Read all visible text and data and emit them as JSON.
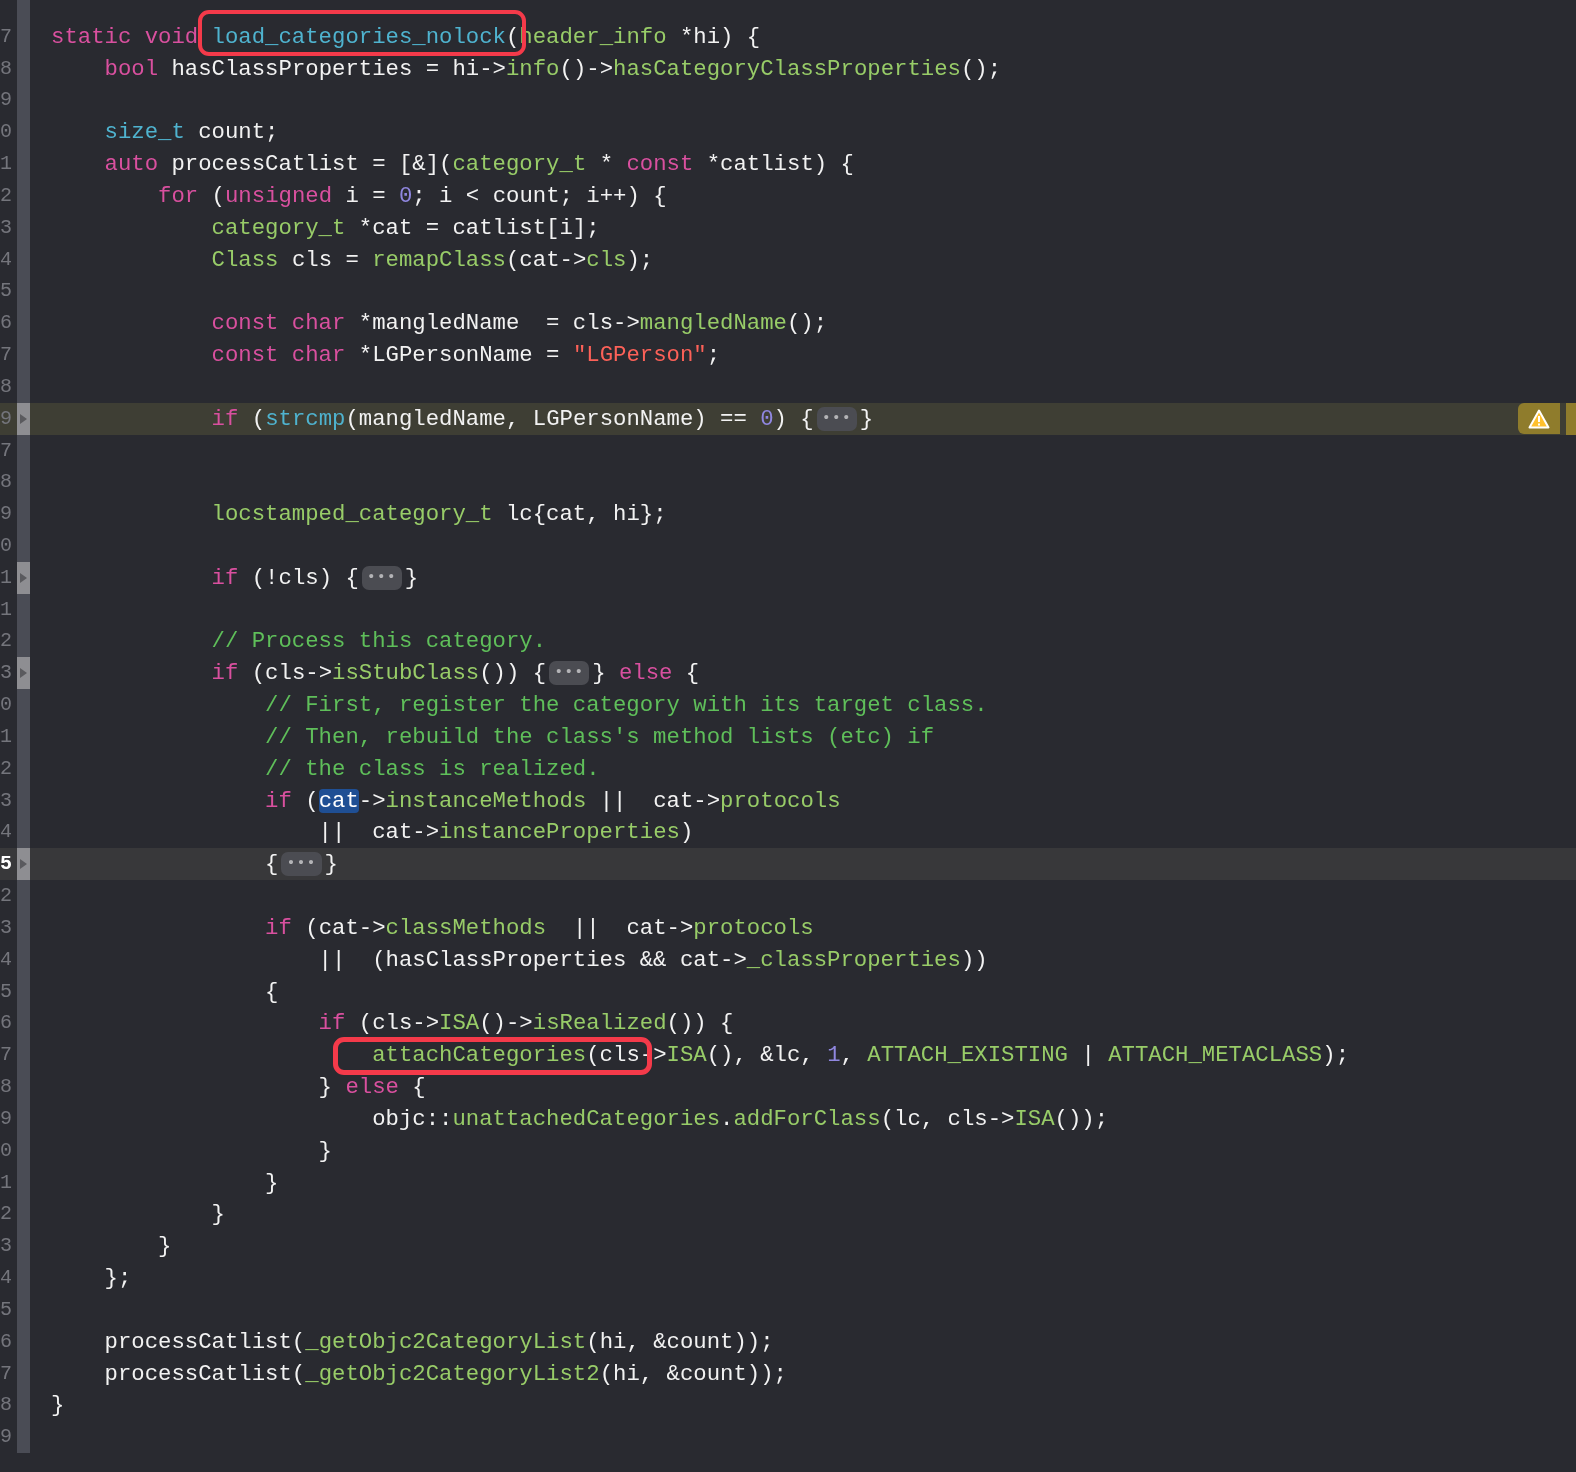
{
  "lines": [
    {
      "folded": false,
      "current": false,
      "warning": false
    },
    {
      "number": "7",
      "folded": false,
      "current": false,
      "warning": false,
      "tokens": [
        {
          "text": "static void",
          "kind": "keyword"
        },
        {
          "text": " load_categories_nolock",
          "kind": "declaration"
        },
        {
          "text": "(",
          "kind": "plain"
        },
        {
          "text": "header_info",
          "kind": "project"
        },
        {
          "text": " *hi) {",
          "kind": "plain"
        }
      ]
    },
    {
      "number": "8",
      "folded": false,
      "current": false,
      "warning": false,
      "tokens": [
        {
          "text": "    bool",
          "kind": "keyword"
        },
        {
          "text": " hasClassProperties = hi->",
          "kind": "plain"
        },
        {
          "text": "info",
          "kind": "project"
        },
        {
          "text": "()->",
          "kind": "plain"
        },
        {
          "text": "hasCategoryClassProperties",
          "kind": "project"
        },
        {
          "text": "();",
          "kind": "plain"
        }
      ]
    },
    {
      "number": "9",
      "folded": false,
      "current": false,
      "warning": false
    },
    {
      "number": "0",
      "folded": false,
      "current": false,
      "warning": false,
      "tokens": [
        {
          "text": "    size_t",
          "kind": "declaration"
        },
        {
          "text": " count;",
          "kind": "plain"
        }
      ]
    },
    {
      "number": "1",
      "folded": false,
      "current": false,
      "warning": false,
      "tokens": [
        {
          "text": "    auto",
          "kind": "keyword"
        },
        {
          "text": " processCatlist = [&](",
          "kind": "plain"
        },
        {
          "text": "category_t",
          "kind": "project"
        },
        {
          "text": " * ",
          "kind": "plain"
        },
        {
          "text": "const",
          "kind": "keyword"
        },
        {
          "text": " *catlist) {",
          "kind": "plain"
        }
      ]
    },
    {
      "number": "2",
      "folded": false,
      "current": false,
      "warning": false,
      "tokens": [
        {
          "text": "        for",
          "kind": "keyword"
        },
        {
          "text": " (",
          "kind": "plain"
        },
        {
          "text": "unsigned",
          "kind": "keyword"
        },
        {
          "text": " i = ",
          "kind": "plain"
        },
        {
          "text": "0",
          "kind": "number"
        },
        {
          "text": "; i < count; i++) {",
          "kind": "plain"
        }
      ]
    },
    {
      "number": "3",
      "folded": false,
      "current": false,
      "warning": false,
      "tokens": [
        {
          "text": "            category_t",
          "kind": "project"
        },
        {
          "text": " *cat = catlist[i];",
          "kind": "plain"
        }
      ]
    },
    {
      "number": "4",
      "folded": false,
      "current": false,
      "warning": false,
      "tokens": [
        {
          "text": "            Class",
          "kind": "project"
        },
        {
          "text": " cls = ",
          "kind": "plain"
        },
        {
          "text": "remapClass",
          "kind": "project"
        },
        {
          "text": "(cat->",
          "kind": "plain"
        },
        {
          "text": "cls",
          "kind": "project"
        },
        {
          "text": ");",
          "kind": "plain"
        }
      ]
    },
    {
      "number": "5",
      "folded": false,
      "current": false,
      "warning": false
    },
    {
      "number": "6",
      "folded": false,
      "current": false,
      "warning": false,
      "tokens": [
        {
          "text": "            const char",
          "kind": "keyword"
        },
        {
          "text": " *mangledName  = cls->",
          "kind": "plain"
        },
        {
          "text": "mangledName",
          "kind": "project"
        },
        {
          "text": "();",
          "kind": "plain"
        }
      ]
    },
    {
      "number": "7",
      "folded": false,
      "current": false,
      "warning": false,
      "tokens": [
        {
          "text": "            const char",
          "kind": "keyword"
        },
        {
          "text": " *LGPersonName = ",
          "kind": "plain"
        },
        {
          "text": "\"LGPerson\"",
          "kind": "string"
        },
        {
          "text": ";",
          "kind": "plain"
        }
      ]
    },
    {
      "number": "8",
      "folded": false,
      "current": false,
      "warning": false
    },
    {
      "number": "9",
      "folded": true,
      "current": false,
      "warning": true,
      "tokens": [
        {
          "text": "            if",
          "kind": "keyword"
        },
        {
          "text": " (",
          "kind": "plain"
        },
        {
          "text": "strcmp",
          "kind": "declaration"
        },
        {
          "text": "(mangledName, LGPersonName) == ",
          "kind": "plain"
        },
        {
          "text": "0",
          "kind": "number"
        },
        {
          "text": ") {",
          "kind": "plain"
        },
        {
          "text": "•••",
          "kind": "fold"
        },
        {
          "text": "}",
          "kind": "plain"
        }
      ]
    },
    {
      "number": "7",
      "folded": false,
      "current": false,
      "warning": false
    },
    {
      "number": "8",
      "folded": false,
      "current": false,
      "warning": false
    },
    {
      "number": "9",
      "folded": false,
      "current": false,
      "warning": false,
      "tokens": [
        {
          "text": "            locstamped_category_t",
          "kind": "project"
        },
        {
          "text": " lc{cat, hi};",
          "kind": "plain"
        }
      ]
    },
    {
      "number": "0",
      "folded": false,
      "current": false,
      "warning": false
    },
    {
      "number": "1",
      "folded": true,
      "current": false,
      "warning": false,
      "tokens": [
        {
          "text": "            if",
          "kind": "keyword"
        },
        {
          "text": " (!cls) {",
          "kind": "plain"
        },
        {
          "text": "•••",
          "kind": "fold"
        },
        {
          "text": "}",
          "kind": "plain"
        }
      ]
    },
    {
      "number": "1",
      "folded": false,
      "current": false,
      "warning": false
    },
    {
      "number": "2",
      "folded": false,
      "current": false,
      "warning": false,
      "tokens": [
        {
          "text": "            // Process this category.",
          "kind": "comment"
        }
      ]
    },
    {
      "number": "3",
      "folded": true,
      "current": false,
      "warning": false,
      "tokens": [
        {
          "text": "            if",
          "kind": "keyword"
        },
        {
          "text": " (cls->",
          "kind": "plain"
        },
        {
          "text": "isStubClass",
          "kind": "project"
        },
        {
          "text": "()) {",
          "kind": "plain"
        },
        {
          "text": "•••",
          "kind": "fold"
        },
        {
          "text": "} ",
          "kind": "plain"
        },
        {
          "text": "else",
          "kind": "keyword"
        },
        {
          "text": " {",
          "kind": "plain"
        }
      ]
    },
    {
      "number": "0",
      "folded": false,
      "current": false,
      "warning": false,
      "tokens": [
        {
          "text": "                // First, register the category with its target class.",
          "kind": "comment"
        }
      ]
    },
    {
      "number": "1",
      "folded": false,
      "current": false,
      "warning": false,
      "tokens": [
        {
          "text": "                // Then, rebuild the class's method lists (etc) if",
          "kind": "comment"
        }
      ]
    },
    {
      "number": "2",
      "folded": false,
      "current": false,
      "warning": false,
      "tokens": [
        {
          "text": "                // the class is realized.",
          "kind": "comment"
        }
      ]
    },
    {
      "number": "3",
      "folded": false,
      "current": false,
      "warning": false,
      "tokens": [
        {
          "text": "                if",
          "kind": "keyword"
        },
        {
          "text": " (",
          "kind": "plain"
        },
        {
          "text": "cat",
          "kind": "selection"
        },
        {
          "text": "->",
          "kind": "plain"
        },
        {
          "text": "instanceMethods",
          "kind": "project"
        },
        {
          "text": " ||  cat->",
          "kind": "plain"
        },
        {
          "text": "protocols",
          "kind": "project"
        }
      ]
    },
    {
      "number": "4",
      "folded": false,
      "current": false,
      "warning": false,
      "tokens": [
        {
          "text": "                    ||  cat->",
          "kind": "plain"
        },
        {
          "text": "instanceProperties",
          "kind": "project"
        },
        {
          "text": ")",
          "kind": "plain"
        }
      ]
    },
    {
      "number": "5",
      "folded": true,
      "current": true,
      "warning": false,
      "tokens": [
        {
          "text": "                {",
          "kind": "plain"
        },
        {
          "text": "•••",
          "kind": "fold"
        },
        {
          "text": "}",
          "kind": "plain"
        }
      ]
    },
    {
      "number": "2",
      "folded": false,
      "current": false,
      "warning": false
    },
    {
      "number": "3",
      "folded": false,
      "current": false,
      "warning": false,
      "tokens": [
        {
          "text": "                if",
          "kind": "keyword"
        },
        {
          "text": " (cat->",
          "kind": "plain"
        },
        {
          "text": "classMethods",
          "kind": "project"
        },
        {
          "text": "  ||  cat->",
          "kind": "plain"
        },
        {
          "text": "protocols",
          "kind": "project"
        }
      ]
    },
    {
      "number": "4",
      "folded": false,
      "current": false,
      "warning": false,
      "tokens": [
        {
          "text": "                    ||  (hasClassProperties && cat->",
          "kind": "plain"
        },
        {
          "text": "_classProperties",
          "kind": "project"
        },
        {
          "text": "))",
          "kind": "plain"
        }
      ]
    },
    {
      "number": "5",
      "folded": false,
      "current": false,
      "warning": false,
      "tokens": [
        {
          "text": "                {",
          "kind": "plain"
        }
      ]
    },
    {
      "number": "6",
      "folded": false,
      "current": false,
      "warning": false,
      "tokens": [
        {
          "text": "                    if",
          "kind": "keyword"
        },
        {
          "text": " (cls->",
          "kind": "plain"
        },
        {
          "text": "ISA",
          "kind": "project"
        },
        {
          "text": "()->",
          "kind": "plain"
        },
        {
          "text": "isRealized",
          "kind": "project"
        },
        {
          "text": "()) {",
          "kind": "plain"
        }
      ]
    },
    {
      "number": "7",
      "folded": false,
      "current": false,
      "warning": false,
      "tokens": [
        {
          "text": "                        attachCategories",
          "kind": "project"
        },
        {
          "text": "(cls->",
          "kind": "plain"
        },
        {
          "text": "ISA",
          "kind": "project"
        },
        {
          "text": "(), &lc, ",
          "kind": "plain"
        },
        {
          "text": "1",
          "kind": "number"
        },
        {
          "text": ", ",
          "kind": "plain"
        },
        {
          "text": "ATTACH_EXISTING",
          "kind": "project"
        },
        {
          "text": " | ",
          "kind": "plain"
        },
        {
          "text": "ATTACH_METACLASS",
          "kind": "project"
        },
        {
          "text": ");",
          "kind": "plain"
        }
      ]
    },
    {
      "number": "8",
      "folded": false,
      "current": false,
      "warning": false,
      "tokens": [
        {
          "text": "                    } ",
          "kind": "plain"
        },
        {
          "text": "else",
          "kind": "keyword"
        },
        {
          "text": " {",
          "kind": "plain"
        }
      ]
    },
    {
      "number": "9",
      "folded": false,
      "current": false,
      "warning": false,
      "tokens": [
        {
          "text": "                        objc::",
          "kind": "plain"
        },
        {
          "text": "unattachedCategories",
          "kind": "project"
        },
        {
          "text": ".",
          "kind": "plain"
        },
        {
          "text": "addForClass",
          "kind": "project"
        },
        {
          "text": "(lc, cls->",
          "kind": "plain"
        },
        {
          "text": "ISA",
          "kind": "project"
        },
        {
          "text": "());",
          "kind": "plain"
        }
      ]
    },
    {
      "number": "0",
      "folded": false,
      "current": false,
      "warning": false,
      "tokens": [
        {
          "text": "                    }",
          "kind": "plain"
        }
      ]
    },
    {
      "number": "1",
      "folded": false,
      "current": false,
      "warning": false,
      "tokens": [
        {
          "text": "                }",
          "kind": "plain"
        }
      ]
    },
    {
      "number": "2",
      "folded": false,
      "current": false,
      "warning": false,
      "tokens": [
        {
          "text": "            }",
          "kind": "plain"
        }
      ]
    },
    {
      "number": "3",
      "folded": false,
      "current": false,
      "warning": false,
      "tokens": [
        {
          "text": "        }",
          "kind": "plain"
        }
      ]
    },
    {
      "number": "4",
      "folded": false,
      "current": false,
      "warning": false,
      "tokens": [
        {
          "text": "    };",
          "kind": "plain"
        }
      ]
    },
    {
      "number": "5",
      "folded": false,
      "current": false,
      "warning": false
    },
    {
      "number": "6",
      "folded": false,
      "current": false,
      "warning": false,
      "tokens": [
        {
          "text": "    processCatlist(",
          "kind": "plain"
        },
        {
          "text": "_getObjc2CategoryList",
          "kind": "project"
        },
        {
          "text": "(hi, &count));",
          "kind": "plain"
        }
      ]
    },
    {
      "number": "7",
      "folded": false,
      "current": false,
      "warning": false,
      "tokens": [
        {
          "text": "    processCatlist(",
          "kind": "plain"
        },
        {
          "text": "_getObjc2CategoryList2",
          "kind": "project"
        },
        {
          "text": "(hi, &count));",
          "kind": "plain"
        }
      ]
    },
    {
      "number": "8",
      "folded": false,
      "current": false,
      "warning": false,
      "tokens": [
        {
          "text": "}",
          "kind": "plain"
        }
      ]
    },
    {
      "number": "9",
      "folded": false,
      "current": false,
      "warning": false
    }
  ]
}
